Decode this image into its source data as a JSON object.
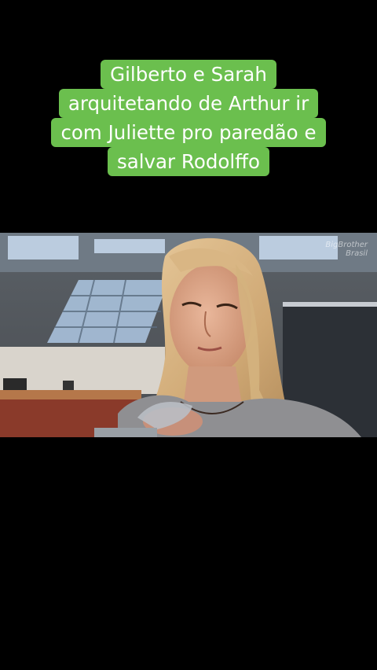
{
  "caption": {
    "lines": [
      "Gilberto e Sarah",
      "arquitetando de Arthur ir",
      "com Juliette pro paredão e",
      "salvar Rodolffo"
    ]
  },
  "video": {
    "watermark_line1": "BigBrother",
    "watermark_line2": "Brasil"
  },
  "colors": {
    "caption_bg": "#6bbf4e",
    "page_bg": "#000000"
  }
}
